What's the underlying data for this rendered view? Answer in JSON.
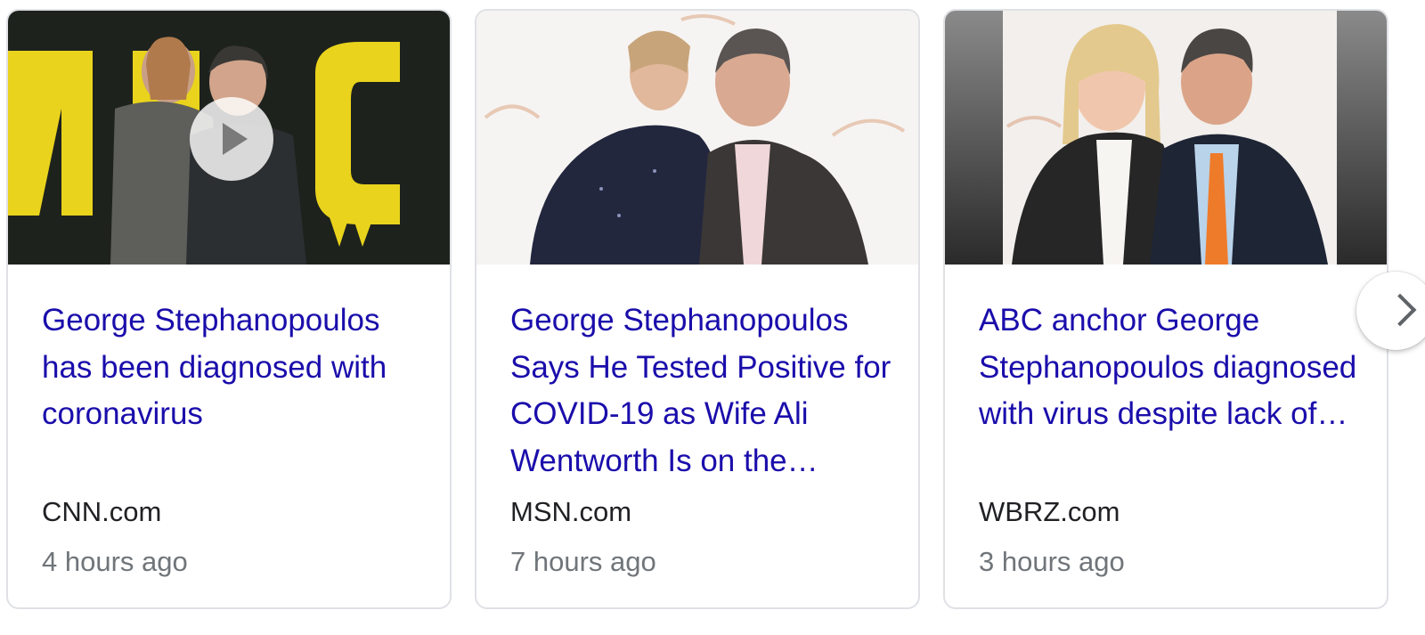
{
  "cards": [
    {
      "title": "George Stephanopoulos has been diagnosed with coronavirus",
      "source": "CNN.com",
      "time": "4 hours ago",
      "thumbnail_icon": "play-icon"
    },
    {
      "title": "George Stephanopoulos Says He Tested Positive for COVID-19 as Wife Ali Wentworth Is on the…",
      "source": "MSN.com",
      "time": "7 hours ago"
    },
    {
      "title": "ABC anchor George Stephanopoulos diagnosed with virus despite lack of…",
      "source": "WBRZ.com",
      "time": "3 hours ago"
    }
  ],
  "next_button": {
    "icon": "chevron-right-icon"
  },
  "colors": {
    "link": "#1a0dab",
    "source": "#202124",
    "time": "#70757a",
    "card_border": "#dfe1e5"
  }
}
